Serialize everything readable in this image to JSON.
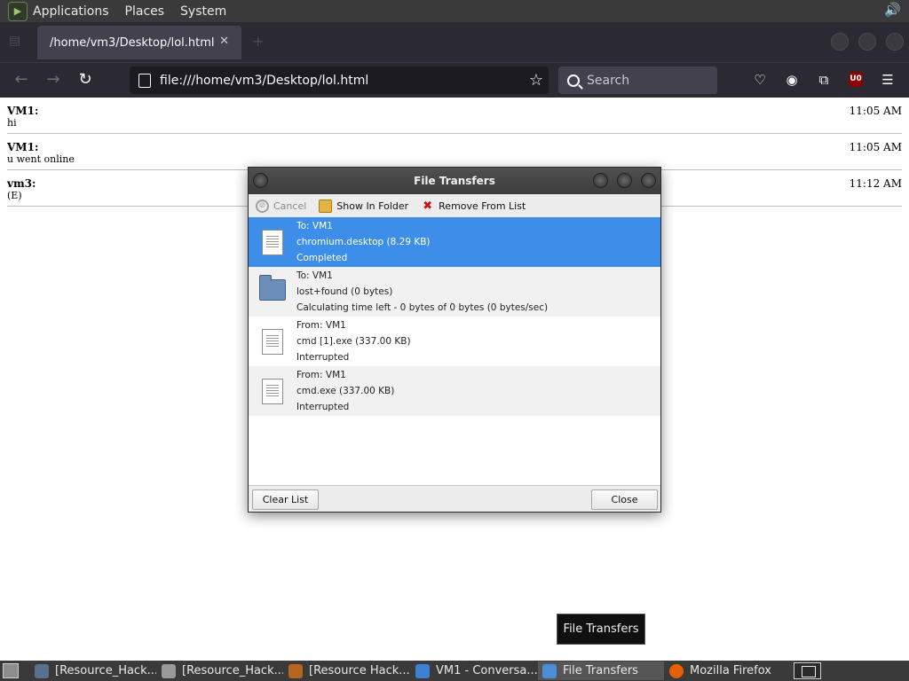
{
  "top_panel": {
    "menus": [
      "Applications",
      "Places",
      "System"
    ],
    "logo_icon": "terminal-logo-icon",
    "volume_icon": "speaker-icon"
  },
  "browser": {
    "tab_title": "/home/vm3/Desktop/lol.html",
    "url": "file:///home/vm3/Desktop/lol.html",
    "search_placeholder": "Search",
    "ublock_label": "U0"
  },
  "chat": {
    "messages": [
      {
        "sender": "VM1:",
        "text": "hi",
        "time": "11:05 AM"
      },
      {
        "sender": "VM1:",
        "text": "u went online",
        "time": "11:05 AM"
      },
      {
        "sender": "vm3:",
        "text": "(E)",
        "time": "11:12 AM"
      }
    ]
  },
  "dialog": {
    "title": "File Transfers",
    "toolbar": {
      "cancel": "Cancel",
      "show_in_folder": "Show In Folder",
      "remove_from_list": "Remove From List"
    },
    "transfers": [
      {
        "direction": "To: VM1",
        "file": "chromium.desktop (8.29 KB)",
        "status": "Completed",
        "icon": "document-icon"
      },
      {
        "direction": "To: VM1",
        "file": "lost+found (0 bytes)",
        "status": "Calculating time left - 0 bytes of 0 bytes (0 bytes/sec)",
        "icon": "folder-icon"
      },
      {
        "direction": "From: VM1",
        "file": "cmd [1].exe (337.00 KB)",
        "status": "Interrupted",
        "icon": "document-icon"
      },
      {
        "direction": "From: VM1",
        "file": "cmd.exe (337.00 KB)",
        "status": "Interrupted",
        "icon": "document-icon"
      }
    ],
    "clear_list": "Clear List",
    "close": "Close"
  },
  "tooltip": "File Transfers",
  "taskbar": {
    "tasks": [
      {
        "label": "[Resource_Hack...",
        "icon": "window-icon"
      },
      {
        "label": "[Resource_Hack...",
        "icon": "folder-icon"
      },
      {
        "label": "[Resource Hack...",
        "icon": "resource-hacker-icon"
      },
      {
        "label": "VM1 - Conversa...",
        "icon": "chat-icon"
      },
      {
        "label": "File Transfers",
        "icon": "transfer-icon"
      },
      {
        "label": "Mozilla Firefox",
        "icon": "firefox-icon"
      }
    ]
  }
}
